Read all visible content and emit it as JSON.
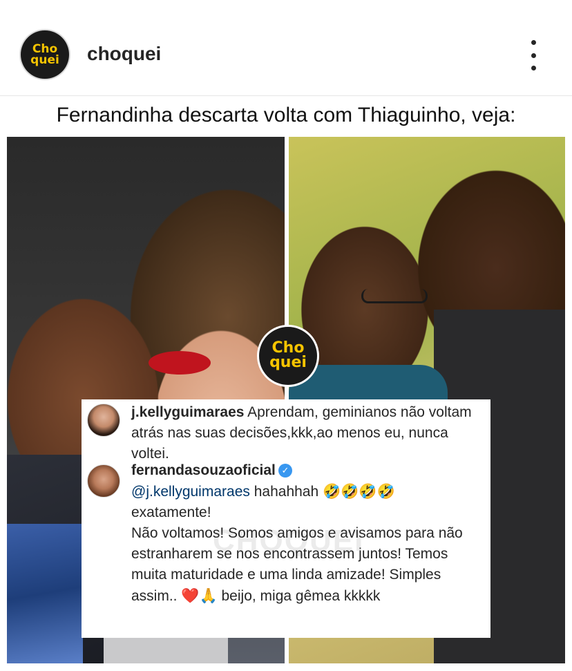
{
  "header": {
    "username": "choquei",
    "avatar_logo_line1": "Cho",
    "avatar_logo_line2": "quei"
  },
  "post": {
    "headline": "Fernandinha descarta volta com Thiaguinho, veja:",
    "watermark_line1": "Cho",
    "watermark_line2": "quei"
  },
  "comments": [
    {
      "username": "j.kellyguimaraes",
      "text": "Aprendam, geminianos não voltam atrás nas suas decisões,kkk,ao menos eu, nunca voltei."
    },
    {
      "username": "fernandasouzaoficial",
      "mention": "@j.kellyguimaraes",
      "text_part1": "hahahhah",
      "emoji_laugh": "🤣🤣🤣🤣",
      "text_part2": "exatamente!",
      "text_part3": "Não voltamos! Somos amigos e avisamos para não estranharem se nos encontrassem juntos! Temos muita maturidade e uma linda amizade! Simples assim..",
      "emoji_heart_pray": "❤️🙏",
      "text_part4": "beijo, miga gêmea kkkkk",
      "background_watermark": "CHOQUEI"
    }
  ],
  "colors": {
    "brand_yellow": "#f6c400",
    "verified_blue": "#3897f0",
    "text": "#262626"
  },
  "icons": {
    "more": "more-vertical-icon",
    "verified": "verified-badge-icon"
  }
}
